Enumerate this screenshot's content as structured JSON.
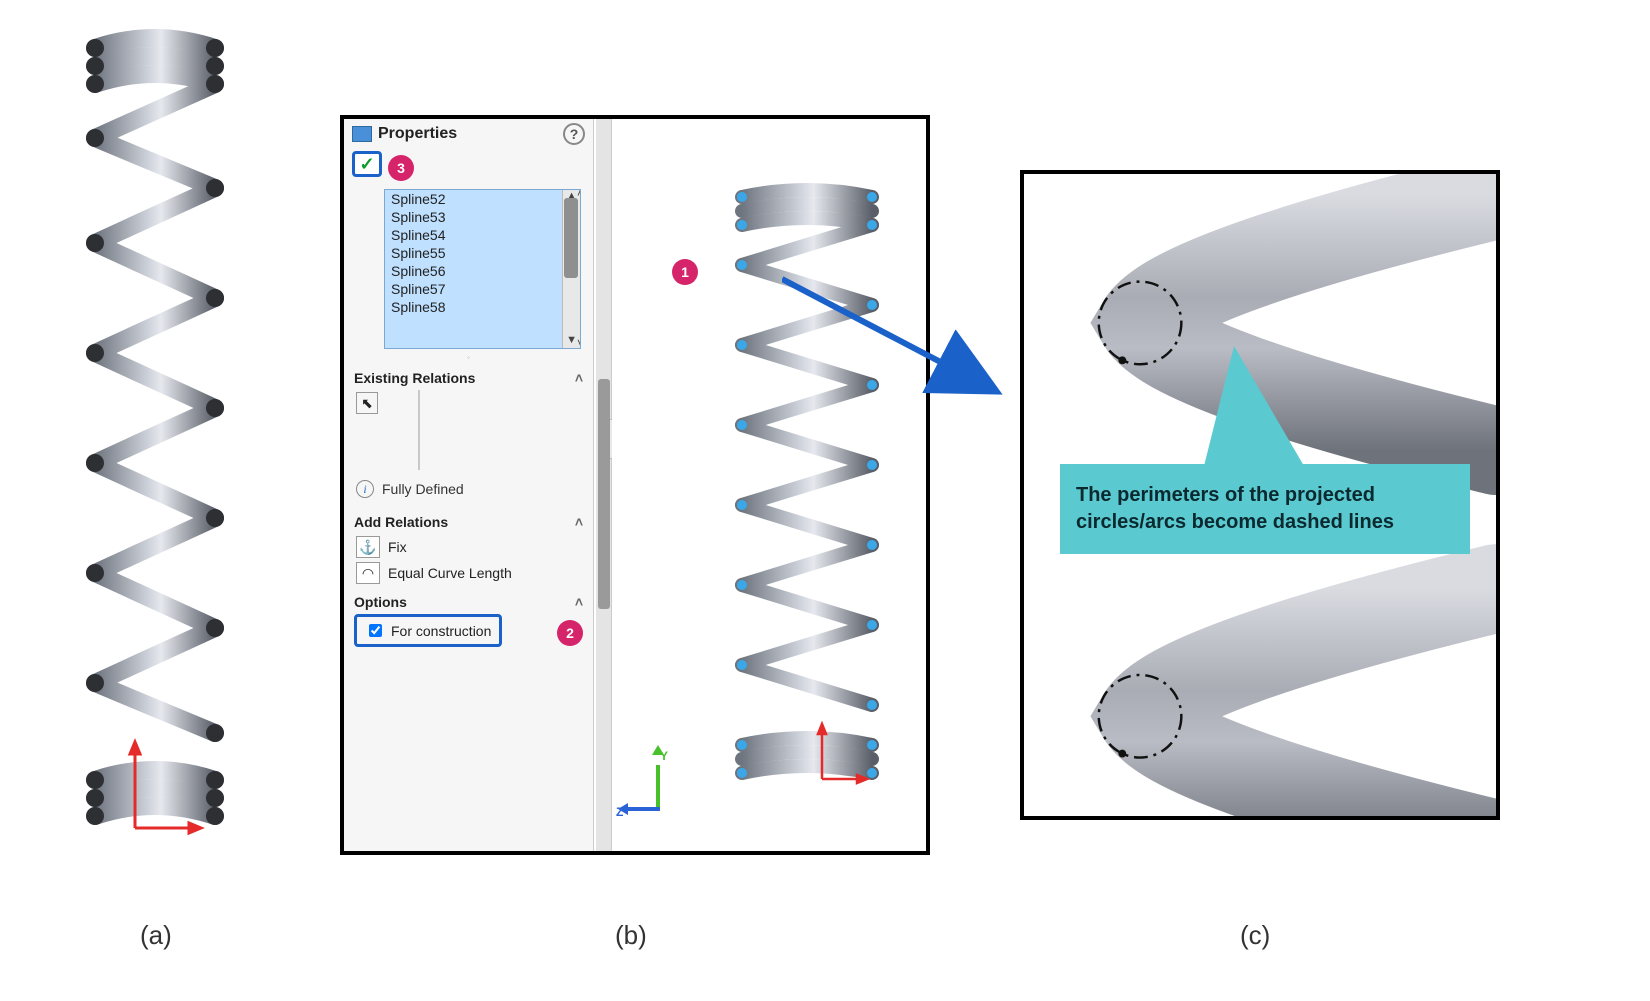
{
  "captions": {
    "a": "(a)",
    "b": "(b)",
    "c": "(c)"
  },
  "panelB": {
    "title": "Properties",
    "splines": [
      "Spline52",
      "Spline53",
      "Spline54",
      "Spline55",
      "Spline56",
      "Spline57",
      "Spline58"
    ],
    "existingRelationsLabel": "Existing Relations",
    "statusLabel": "Fully Defined",
    "addRelationsLabel": "Add Relations",
    "relations": {
      "fix": "Fix",
      "equalCurve": "Equal Curve Length"
    },
    "optionsLabel": "Options",
    "forConstructionLabel": "For construction",
    "forConstructionChecked": true,
    "callouts": {
      "one": "1",
      "two": "2",
      "three": "3"
    },
    "axes": {
      "y": "Y",
      "z": "Z"
    }
  },
  "panelC": {
    "tip": "The perimeters of the projected circles/arcs become dashed lines"
  }
}
